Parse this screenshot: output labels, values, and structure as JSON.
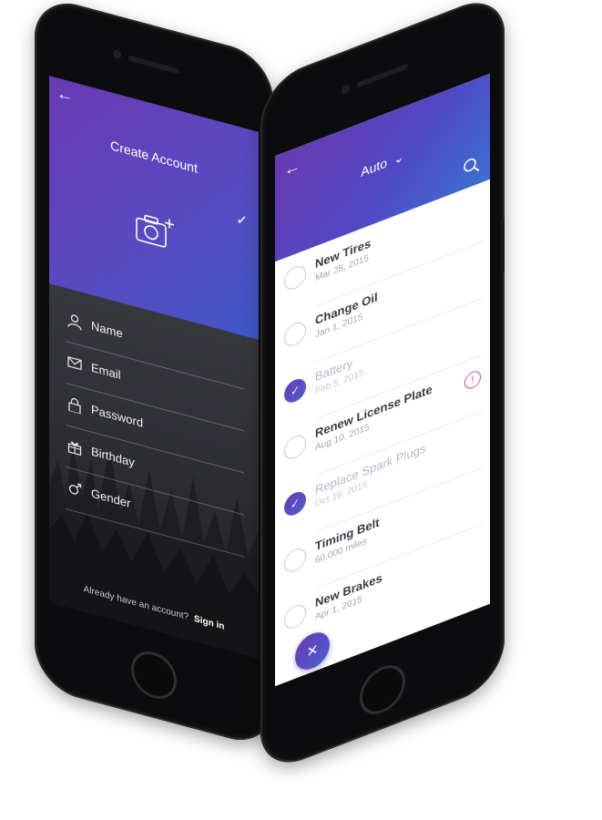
{
  "left_phone": {
    "title": "Create Account",
    "back_icon": "←",
    "confirm_icon": "✓",
    "photo_icon": "camera-add",
    "fields": [
      {
        "label": "Name",
        "icon": "person-icon"
      },
      {
        "label": "Email",
        "icon": "envelope-icon"
      },
      {
        "label": "Password",
        "icon": "lock-icon"
      },
      {
        "label": "Birthday",
        "icon": "gift-icon"
      },
      {
        "label": "Gender",
        "icon": "gender-icon"
      }
    ],
    "footer_prompt": "Already have an account?",
    "footer_link": "Sign in"
  },
  "right_phone": {
    "title": "Auto",
    "title_chevron": "⌄",
    "back_icon": "←",
    "search_icon": "search",
    "tasks": [
      {
        "title": "New Tires",
        "subtitle": "Mar 25, 2015",
        "done": false
      },
      {
        "title": "Change Oil",
        "subtitle": "Jan 1, 2015",
        "done": false
      },
      {
        "title": "Battery",
        "subtitle": "Feb 5, 2015",
        "done": true
      },
      {
        "title": "Renew License Plate",
        "subtitle": "Aug 10, 2015",
        "done": false
      },
      {
        "title": "Replace Spark Plugs",
        "subtitle": "Oct 16, 2015",
        "done": true
      },
      {
        "title": "Timing Belt",
        "subtitle": "60,000 miles",
        "done": false
      },
      {
        "title": "New Brakes",
        "subtitle": "Apr 1, 2015",
        "done": false
      }
    ],
    "alert_icon": "!",
    "fab_icon": "×"
  },
  "colors": {
    "accent_purple": "#6a3ab4",
    "accent_blue": "#3f58c8",
    "device": "#0c0c0e"
  }
}
